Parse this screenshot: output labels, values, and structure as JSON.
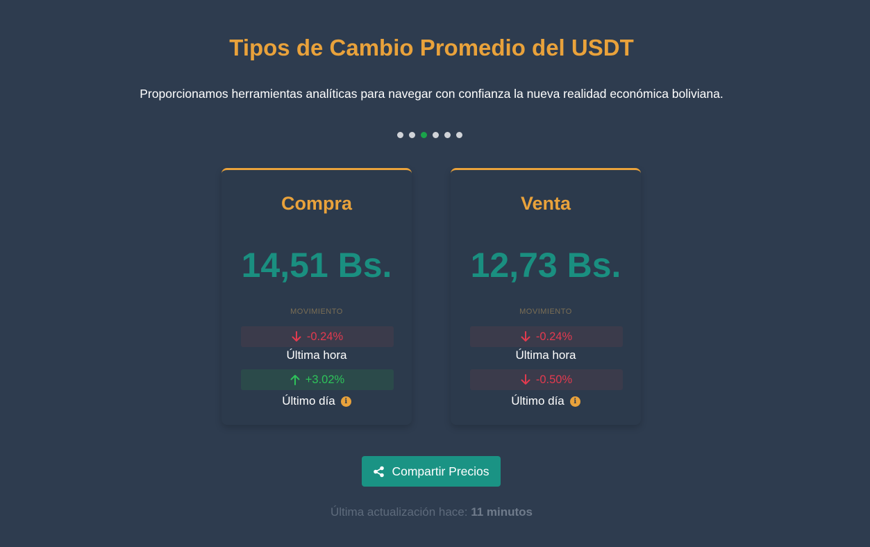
{
  "header": {
    "title": "Tipos de Cambio Promedio del USDT",
    "subtitle": "Proporcionamos herramientas analíticas para navegar con confianza la nueva realidad económica boliviana."
  },
  "carousel": {
    "dot_count": 6,
    "active_index": 2
  },
  "cards": {
    "compra": {
      "title": "Compra",
      "price": "14,51 Bs.",
      "movement_label": "MOVIMIENTO",
      "hour_change": "-0.24%",
      "hour_direction": "down",
      "hour_label": "Última hora",
      "day_change": "+3.02%",
      "day_direction": "up",
      "day_label": "Último día"
    },
    "venta": {
      "title": "Venta",
      "price": "12,73 Bs.",
      "movement_label": "MOVIMIENTO",
      "hour_change": "-0.24%",
      "hour_direction": "down",
      "hour_label": "Última hora",
      "day_change": "-0.50%",
      "day_direction": "down",
      "day_label": "Último día"
    }
  },
  "share": {
    "label": "Compartir Precios",
    "icon": "share-icon"
  },
  "footer": {
    "updated_prefix": "Última actualización hace:",
    "updated_value": "11 minutos"
  },
  "colors": {
    "background": "#2e3c4f",
    "accent": "#e9a23b",
    "price": "#1a8f80",
    "down": "#e33a4f",
    "up": "#2ec35a",
    "button": "#1a9384"
  }
}
